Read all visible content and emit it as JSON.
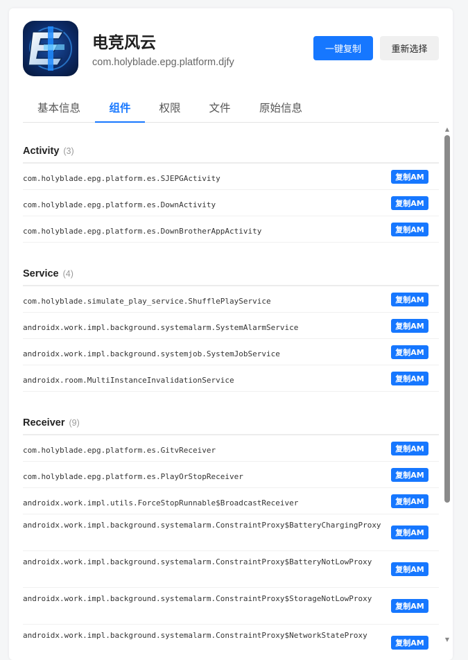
{
  "app": {
    "name": "电竞风云",
    "package": "com.holyblade.epg.platform.djfy",
    "icon": "app-logo-icon"
  },
  "actions": {
    "copy_all": "一键复制",
    "reselect": "重新选择"
  },
  "colors": {
    "accent": "#1677ff"
  },
  "tabs": [
    {
      "label": "基本信息",
      "active": false
    },
    {
      "label": "组件",
      "active": true
    },
    {
      "label": "权限",
      "active": false
    },
    {
      "label": "文件",
      "active": false
    },
    {
      "label": "原始信息",
      "active": false
    }
  ],
  "copy_label": "复制AM",
  "sections": [
    {
      "title": "Activity",
      "count": "(3)",
      "items": [
        "com.holyblade.epg.platform.es.SJEPGActivity",
        "com.holyblade.epg.platform.es.DownActivity",
        "com.holyblade.epg.platform.es.DownBrotherAppActivity"
      ]
    },
    {
      "title": "Service",
      "count": "(4)",
      "items": [
        "com.holyblade.simulate_play_service.ShufflePlayService",
        "androidx.work.impl.background.systemalarm.SystemAlarmService",
        "androidx.work.impl.background.systemjob.SystemJobService",
        "androidx.room.MultiInstanceInvalidationService"
      ]
    },
    {
      "title": "Receiver",
      "count": "(9)",
      "items": [
        "com.holyblade.epg.platform.es.GitvReceiver",
        "com.holyblade.epg.platform.es.PlayOrStopReceiver",
        "androidx.work.impl.utils.ForceStopRunnable$BroadcastReceiver",
        "androidx.work.impl.background.systemalarm.ConstraintProxy$BatteryChargingProxy",
        "androidx.work.impl.background.systemalarm.ConstraintProxy$BatteryNotLowProxy",
        "androidx.work.impl.background.systemalarm.ConstraintProxy$StorageNotLowProxy",
        "androidx.work.impl.background.systemalarm.ConstraintProxy$NetworkStateProxy"
      ]
    }
  ]
}
